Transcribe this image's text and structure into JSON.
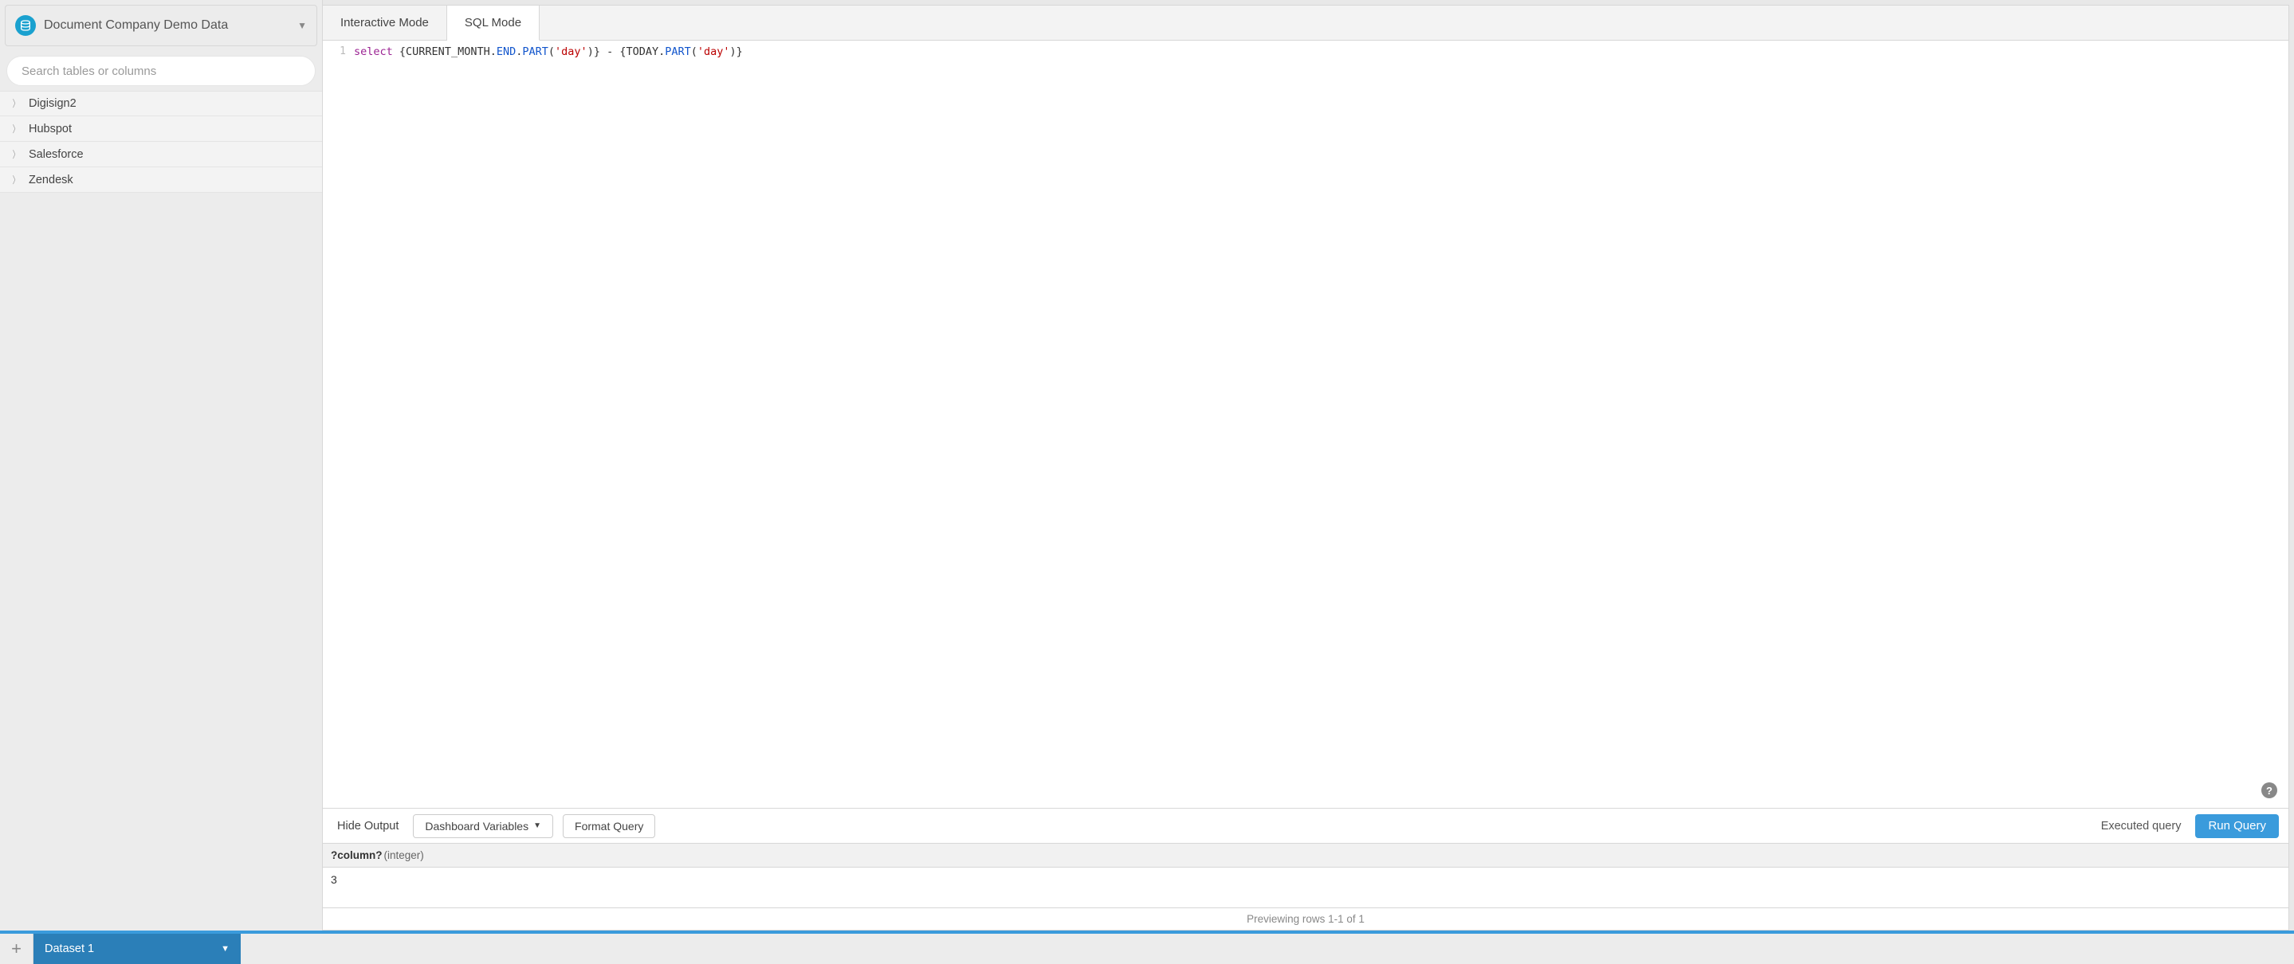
{
  "sidebar": {
    "datasource_name": "Document Company Demo Data",
    "search_placeholder": "Search tables or columns",
    "tables": [
      {
        "name": "Digisign2"
      },
      {
        "name": "Hubspot"
      },
      {
        "name": "Salesforce"
      },
      {
        "name": "Zendesk"
      }
    ]
  },
  "tabs": {
    "interactive": "Interactive Mode",
    "sql": "SQL Mode"
  },
  "editor": {
    "line_number": "1",
    "tokens": {
      "select": "select",
      "brace_open1": " {",
      "const1": "CURRENT_MONTH",
      "dot1": ".",
      "func1": "END",
      "dot2": ".",
      "func2": "PART",
      "paren_open1": "(",
      "str1": "'day'",
      "paren_close1": ")} ",
      "minus": "- {",
      "const2": "TODAY",
      "dot3": ".",
      "func3": "PART",
      "paren_open2": "(",
      "str2": "'day'",
      "paren_close2": ")}"
    }
  },
  "toolbar": {
    "hide_output": "Hide Output",
    "dashboard_variables": "Dashboard Variables",
    "format_query": "Format Query",
    "executed_query": "Executed query",
    "run_query": "Run Query"
  },
  "results": {
    "column_name": "?column?",
    "column_type": "(integer)",
    "row_value": "3",
    "footer": "Previewing rows 1-1 of 1"
  },
  "bottom_tabs": {
    "dataset_name": "Dataset 1"
  }
}
